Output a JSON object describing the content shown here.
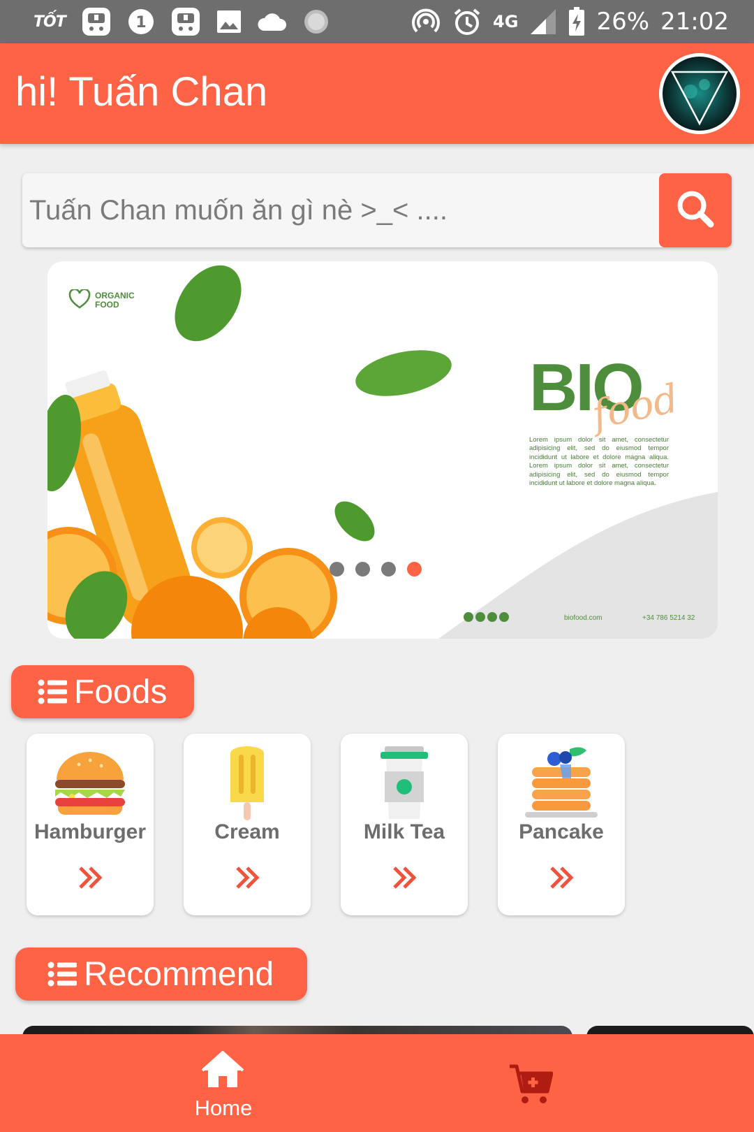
{
  "status_bar": {
    "carrier": "TỐT",
    "network": "4G",
    "battery": "26%",
    "time": "21:02",
    "icons": [
      "carrier-logo-icon",
      "pig-app-icon",
      "number-one-icon",
      "pig-app-icon",
      "image-icon",
      "cloud-icon",
      "loading-icon",
      "hotspot-icon",
      "alarm-icon",
      "network-4g-icon",
      "signal-icon",
      "battery-charging-icon"
    ]
  },
  "header": {
    "greeting": "hi! Tuấn Chan"
  },
  "search": {
    "placeholder": "Tuấn Chan muốn ăn gì nè >_< ...."
  },
  "banner": {
    "logo_text": "ORGANIC FOOD",
    "title_main": "BIO",
    "title_script": "food",
    "body": "Lorem ipsum dolor sit amet, consectetur adipisicing elit, sed do eiusmod tempor incididunt ut labore et dolore magna aliqua. Lorem ipsum dolor sit amet, consectetur adipisicing elit, sed do eiusmod tempor incididunt ut labore et dolore magna aliqua.",
    "website": "biofood.com",
    "phone": "+34 786 5214 32",
    "slide_count": 4,
    "active_slide": 4
  },
  "sections": {
    "foods": "Foods",
    "recommend": "Recommend"
  },
  "foods": [
    {
      "name": "Hamburger",
      "icon": "hamburger-icon"
    },
    {
      "name": "Cream",
      "icon": "popsicle-icon"
    },
    {
      "name": "Milk Tea",
      "icon": "milk-tea-icon"
    },
    {
      "name": "Pancake",
      "icon": "pancake-icon"
    }
  ],
  "bottom_nav": {
    "home_label": "Home",
    "cart_icon": "add-to-cart-icon"
  },
  "colors": {
    "accent": "#fe6346",
    "status_bar": "#6e6e6e",
    "background": "#efefef",
    "text_gray": "#6d6d6d",
    "brand_green": "#4e8d3b"
  }
}
